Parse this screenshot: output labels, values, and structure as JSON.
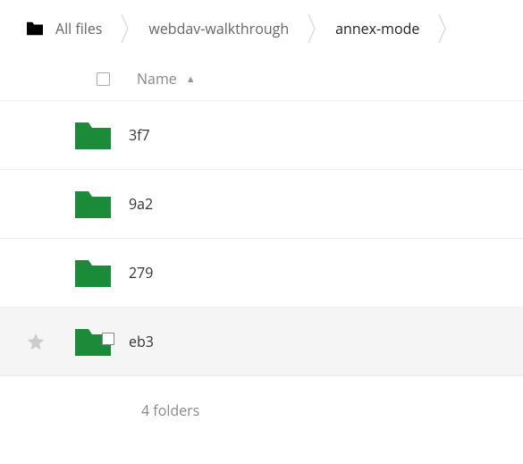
{
  "breadcrumbs": {
    "home_label": "All files",
    "path": [
      "webdav-walkthrough",
      "annex-mode"
    ]
  },
  "table": {
    "name_header": "Name"
  },
  "folders": [
    {
      "name": "3f7",
      "hover": false,
      "overlay": false
    },
    {
      "name": "9a2",
      "hover": false,
      "overlay": false
    },
    {
      "name": "279",
      "hover": false,
      "overlay": false
    },
    {
      "name": "eb3",
      "hover": true,
      "overlay": true
    }
  ],
  "summary": "4 folders",
  "colors": {
    "folder": "#1b8b3a"
  }
}
